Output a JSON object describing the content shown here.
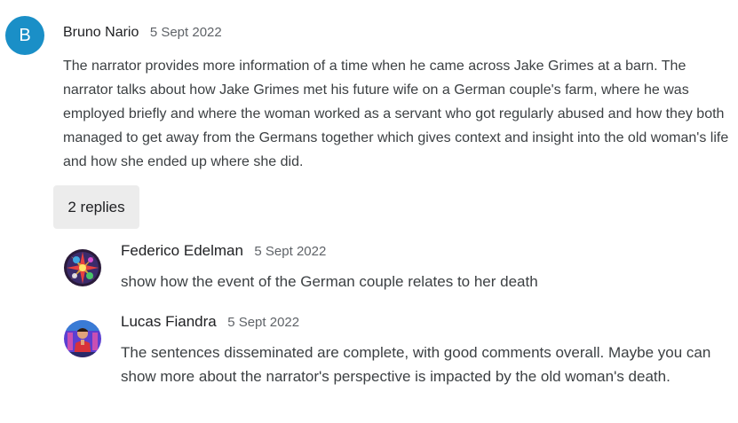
{
  "comment": {
    "avatar_letter": "B",
    "avatar_color": "#1a8fc7",
    "author": "Bruno Nario",
    "date": "5 Sept 2022",
    "text": "The narrator provides more information of a time when he came across Jake Grimes at a barn. The narrator talks about how Jake Grimes met his future wife on a German couple's farm, where he was employed briefly and where the woman worked as a servant who got regularly abused and how they both managed to get away from the Germans together which gives context and insight into the old woman's life and how she ended up where she did."
  },
  "replies_button": {
    "label": "2 replies"
  },
  "replies": [
    {
      "author": "Federico Edelman",
      "date": "5 Sept 2022",
      "text": "show how the event of the German couple relates to her death",
      "avatar_icon": "colorful-abstract-avatar"
    },
    {
      "author": "Lucas Fiandra",
      "date": "5 Sept 2022",
      "text": "The sentences disseminated are complete, with good comments overall. Maybe you can show more about the narrator's perspective is impacted by the old woman's death.",
      "avatar_icon": "person-photo-avatar"
    }
  ]
}
